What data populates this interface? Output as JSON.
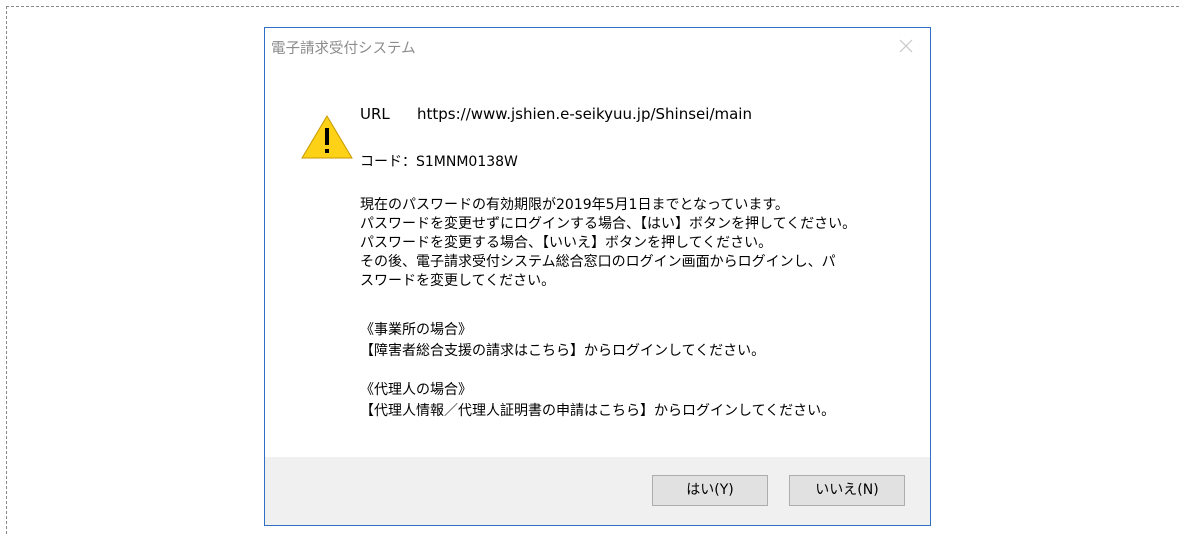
{
  "dialog": {
    "title": "電子請求受付システム",
    "url_label": "URL",
    "url_value": "https://www.jshien.e-seikyuu.jp/Shinsei/main",
    "code_line": "コード：S1MNM0138W",
    "message_lines": [
      "現在のパスワードの有効期限が2019年5月1日までとなっています。",
      "パスワードを変更せずにログインする場合、【はい】ボタンを押してください。",
      "パスワードを変更する場合、【いいえ】ボタンを押してください。",
      "その後、電子請求受付システム総合窓口のログイン画面からログインし、パ",
      "スワードを変更してください。"
    ],
    "section_office": {
      "heading": "《事業所の場合》",
      "text": "【障害者総合支援の請求はこちら】からログインしてください。"
    },
    "section_agent": {
      "heading": "《代理人の場合》",
      "text": "【代理人情報／代理人証明書の申請はこちら】からログインしてください。"
    },
    "buttons": {
      "yes": "はい(Y)",
      "no": "いいえ(N)"
    }
  },
  "icons": {
    "warning": "warning-icon",
    "close": "close-icon"
  },
  "colors": {
    "dialog_border": "#2f6fc4",
    "warning_fill": "#fcd116",
    "footer_bg": "#f0f0f0",
    "button_bg": "#e1e1e1"
  }
}
